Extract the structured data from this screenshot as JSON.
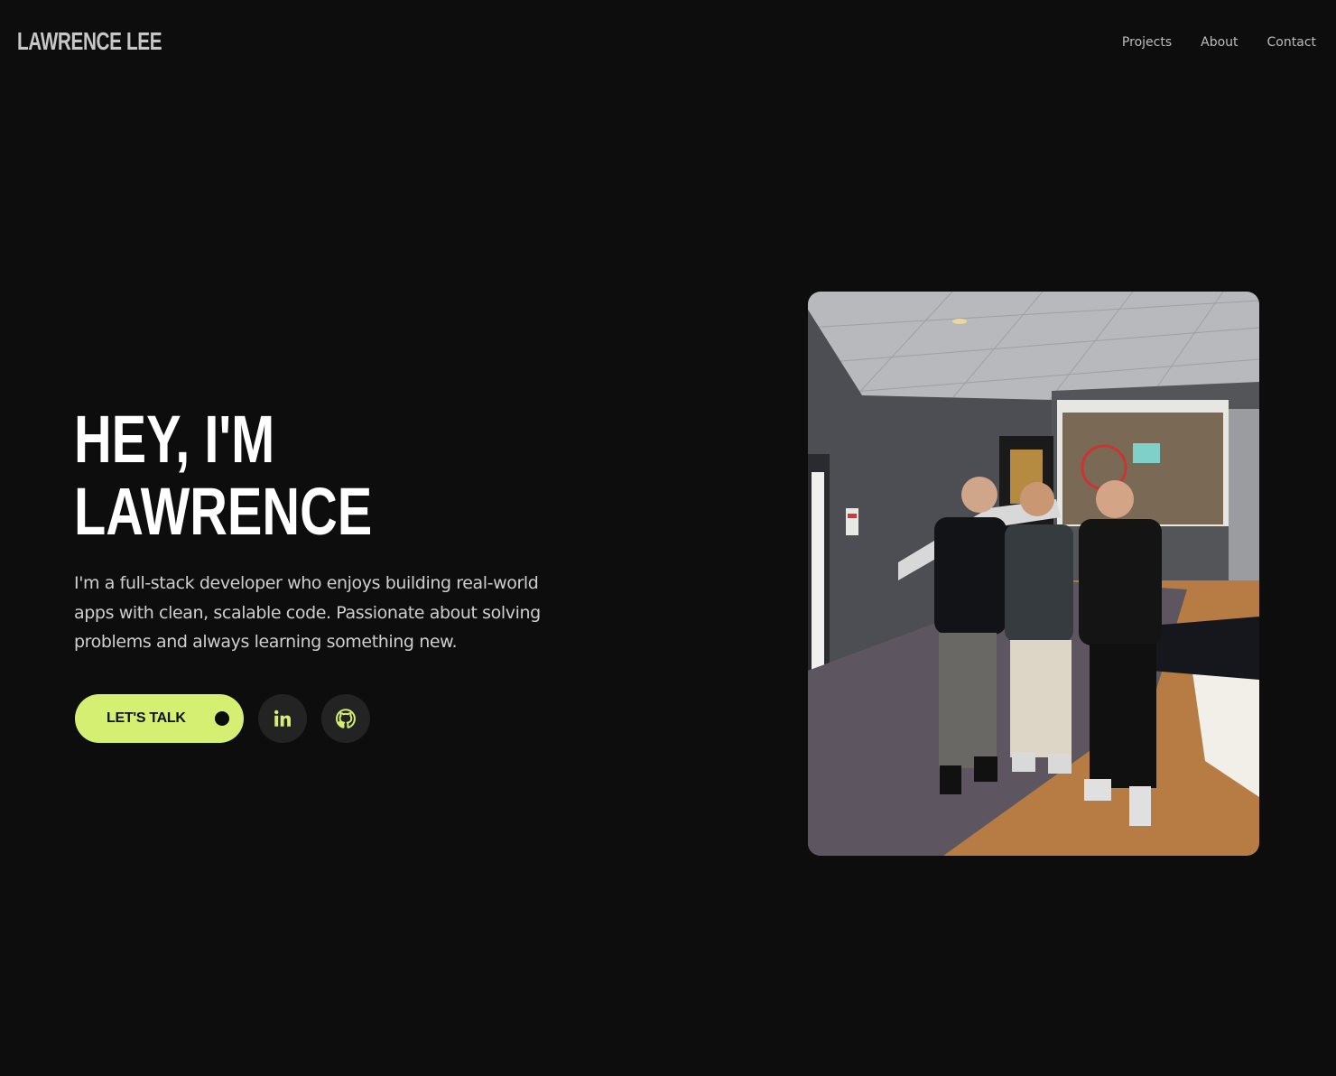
{
  "header": {
    "logo": "LAWRENCE LEE",
    "nav": [
      {
        "label": "Projects"
      },
      {
        "label": "About"
      },
      {
        "label": "Contact"
      }
    ]
  },
  "hero": {
    "title_line1": "HEY, I'M",
    "title_line2": "LAWRENCE",
    "description": "I'm a full-stack developer who enjoys building real-world apps with clean, scalable code. Passionate about solving problems and always learning something new.",
    "cta_label": "LET'S TALK",
    "social": [
      {
        "icon": "linkedin-icon"
      },
      {
        "icon": "github-icon"
      }
    ]
  },
  "colors": {
    "background": "#0d0d0d",
    "accent": "#d4ef72",
    "social_bg": "#232323"
  },
  "photo": {
    "subject": "photo of three people standing together in a function room"
  }
}
